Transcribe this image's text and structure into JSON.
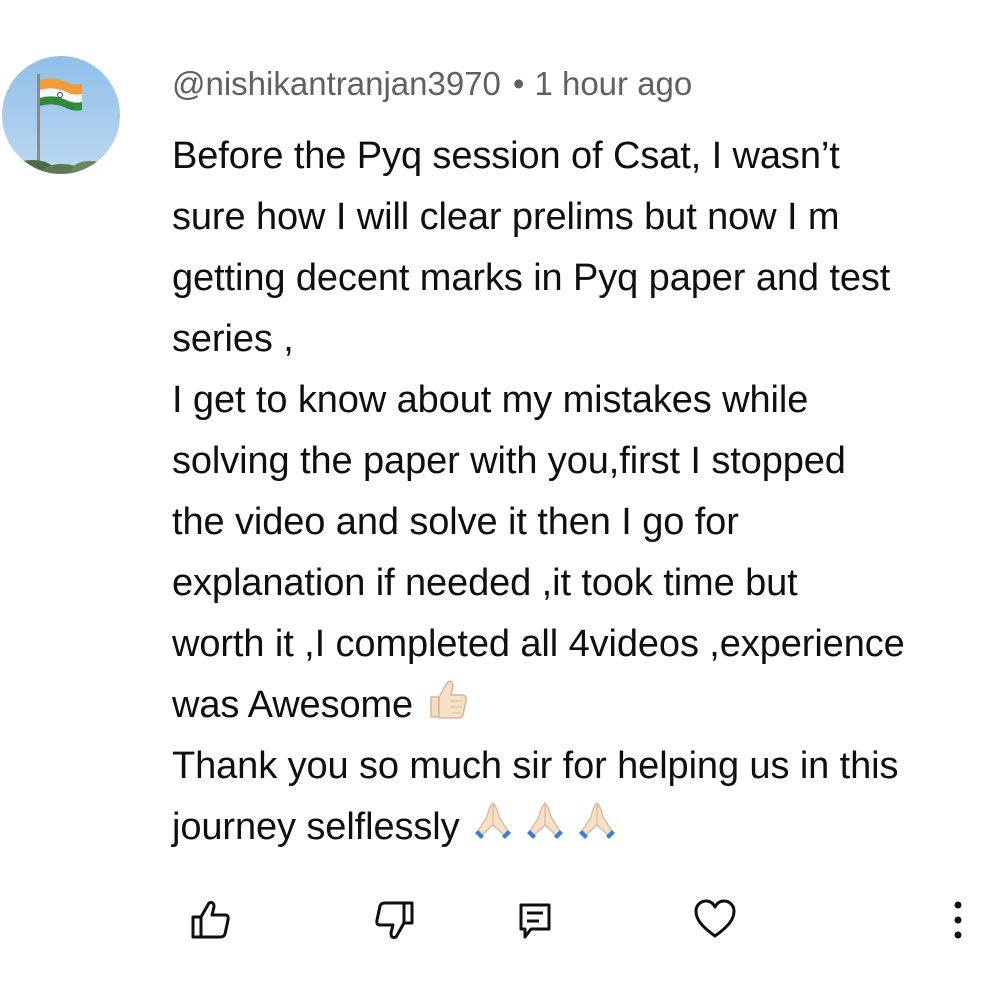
{
  "comment": {
    "author": "@nishikantranjan3970",
    "separator": "•",
    "time": "1 hour ago",
    "lines": [
      "Before the Pyq session of Csat, I wasn’t",
      "sure how I will clear prelims but now I m",
      "getting decent marks in Pyq paper and test",
      "series ,",
      "I get to know about my mistakes while",
      "solving the paper with you,first I stopped",
      "the video and solve it then I go for",
      "explanation if needed ,it took time but",
      "worth it ,I completed all 4videos ,experience",
      "was Awesome",
      "Thank you so much sir for helping us in this",
      "journey selflessly"
    ],
    "emoji": {
      "after_line_10": "thumbs-up",
      "after_line_12": [
        "folded-hands",
        "folded-hands",
        "folded-hands"
      ]
    }
  },
  "actions": {
    "like": "thumbs-up-outline-icon",
    "dislike": "thumbs-down-outline-icon",
    "reply": "reply-comment-icon",
    "heart": "heart-outline-icon",
    "more": "more-vertical-icon"
  },
  "colors": {
    "text": "#0f0f0f",
    "meta": "#606060",
    "background": "#ffffff"
  }
}
